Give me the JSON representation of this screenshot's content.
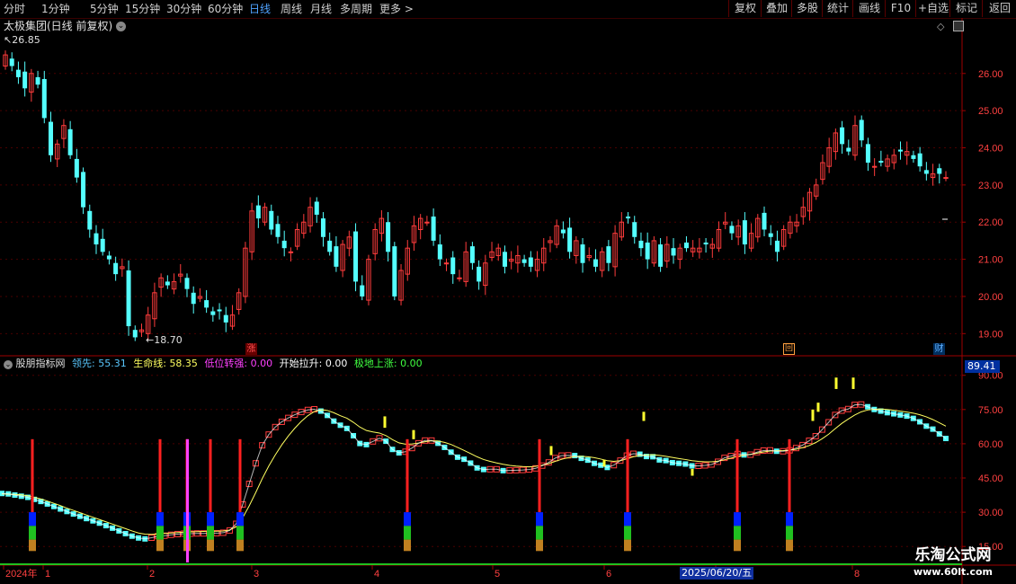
{
  "toolbar": {
    "periods": [
      "分时",
      "1分钟",
      "5分钟",
      "15分钟",
      "30分钟",
      "60分钟",
      "日线",
      "周线",
      "月线",
      "多周期",
      "更多 >"
    ],
    "active": "日线",
    "right_buttons": [
      "复权",
      "叠加",
      "多股",
      "统计",
      "画线",
      "F10",
      "+自选",
      "标记",
      "返回"
    ]
  },
  "main_chart": {
    "title": "太极集团(日线 前复权)",
    "high_label": "26.85",
    "low_label": "18.70",
    "y_ticks": [
      "26.00",
      "25.00",
      "24.00",
      "23.00",
      "22.00",
      "21.00",
      "20.00",
      "19.00"
    ],
    "markers": [
      {
        "text": "涨",
        "color": "#ff3030"
      },
      {
        "text": "回",
        "color": "#ffa040"
      },
      {
        "text": "财",
        "color": "#40a0ff"
      }
    ]
  },
  "indicator": {
    "name": "股朋指标网",
    "items": [
      {
        "label": "领先:",
        "value": "55.31",
        "color": "#5ac8ff"
      },
      {
        "label": "生命线:",
        "value": "58.35",
        "color": "#ffff60"
      },
      {
        "label": "低位转强:",
        "value": "0.00",
        "color": "#ff40ff"
      },
      {
        "label": "开始拉升:",
        "value": "0.00",
        "color": "#ffffff"
      },
      {
        "label": "极地上涨:",
        "value": "0.00",
        "color": "#40ff40"
      }
    ],
    "current_value": "89.41",
    "y_ticks": [
      "90.00",
      "75.00",
      "60.00",
      "45.00",
      "30.00",
      "15.00"
    ]
  },
  "time_axis": {
    "labels": [
      "2024年",
      "1",
      "2",
      "3",
      "4",
      "5",
      "6",
      "7",
      "8"
    ],
    "highlight": "2025/06/20/五"
  },
  "watermark": {
    "title": "乐淘公式网",
    "url": "www.60lt.com"
  },
  "colors": {
    "up": "#ff3c3c",
    "down": "#54ffff",
    "axis": "#a00000",
    "grid": "#4a0000",
    "life": "#ffff60"
  },
  "chart_data": [
    {
      "type": "candlestick",
      "title": "太极集团(日线 前复权)",
      "ylim": [
        18.5,
        27.3
      ],
      "close": [
        26.5,
        26.2,
        25.9,
        25.6,
        26.0,
        25.7,
        24.8,
        23.8,
        24.1,
        24.6,
        23.8,
        23.2,
        22.4,
        21.8,
        21.4,
        21.2,
        21.0,
        20.6,
        20.8,
        19.2,
        18.9,
        19.1,
        19.5,
        20.1,
        20.5,
        20.3,
        20.4,
        20.6,
        20.2,
        19.8,
        20.0,
        19.7,
        19.5,
        19.6,
        19.3,
        19.5,
        20.1,
        21.3,
        22.3,
        22.1,
        22.4,
        21.8,
        21.6,
        21.3,
        21.2,
        21.8,
        22.0,
        22.4,
        22.2,
        21.6,
        21.2,
        20.8,
        21.4,
        21.6,
        20.4,
        20.0,
        21.0,
        21.8,
        22.1,
        21.2,
        20.0,
        20.7,
        21.3,
        21.9,
        22.1,
        22.0,
        21.5,
        21.0,
        20.9,
        20.6,
        20.5,
        21.2,
        20.9,
        20.4,
        20.9,
        21.2,
        21.3,
        20.8,
        21.0,
        21.1,
        20.9,
        20.8,
        21.0,
        21.3,
        21.5,
        21.9,
        21.7,
        21.2,
        21.5,
        20.9,
        21.1,
        20.8,
        21.2,
        20.9,
        21.7,
        22.0,
        22.1,
        21.6,
        21.3,
        21.0,
        21.5,
        20.8,
        21.4,
        21.1,
        21.3,
        21.3,
        21.3,
        21.3,
        21.4,
        21.4,
        21.8,
        22.0,
        21.7,
        21.9,
        21.4,
        21.7,
        22.1,
        21.8,
        21.6,
        21.2,
        21.8,
        22.0,
        22.0,
        22.4,
        22.8,
        23.0,
        23.6,
        24.0,
        24.4,
        24.1,
        23.9,
        24.6,
        24.2,
        23.6,
        23.5,
        23.6,
        23.7,
        23.8,
        23.9,
        23.9,
        23.7,
        23.5,
        23.3,
        23.3,
        23.3,
        23.2
      ]
    },
    {
      "type": "bar",
      "title": "股朋指标网",
      "ylim": [
        8,
        95
      ],
      "series": [
        {
          "name": "领先",
          "values": [
            39.4,
            39.2,
            38.7,
            38.2,
            37.7,
            36.8,
            35.9,
            34.8,
            33.7,
            32.6,
            31.5,
            30.4,
            29.4,
            28.4,
            27.4,
            26.4,
            25.3,
            24.2,
            23.0,
            21.8,
            20.7,
            19.9,
            19.5,
            20.0,
            20.7,
            20.9,
            21.3,
            21.6,
            21.8,
            21.8,
            21.9,
            21.9,
            22.0,
            22.0,
            22.2,
            23.2,
            26.1,
            34.6,
            43.6,
            52.6,
            60.5,
            65.2,
            68.5,
            70.8,
            72.5,
            73.9,
            75.1,
            76.0,
            76.3,
            75.5,
            73.6,
            71.1,
            69.3,
            67.9,
            64.7,
            61.3,
            60.8,
            62.2,
            63.6,
            62.3,
            58.7,
            57.2,
            57.7,
            59.3,
            61.4,
            62.6,
            62.6,
            61.4,
            59.6,
            57.5,
            55.3,
            54.4,
            52.7,
            50.6,
            49.9,
            50.0,
            50.0,
            49.4,
            49.5,
            49.6,
            49.7,
            49.9,
            50.4,
            51.6,
            53.0,
            54.9,
            56.0,
            56.1,
            56.0,
            54.8,
            54.0,
            52.6,
            51.8,
            50.8,
            51.8,
            53.8,
            56.0,
            56.8,
            56.6,
            55.6,
            55.5,
            54.1,
            53.8,
            52.9,
            52.6,
            52.3,
            51.5,
            51.5,
            51.7,
            52.1,
            53.3,
            55.0,
            55.8,
            56.7,
            56.3,
            56.4,
            57.5,
            58.2,
            58.3,
            57.9,
            57.9,
            58.3,
            59.3,
            60.6,
            62.5,
            64.5,
            67.4,
            70.6,
            73.8,
            75.7,
            76.4,
            78.2,
            78.4,
            77.4,
            76.2,
            75.5,
            74.8,
            74.3,
            73.8,
            73.3,
            72.3,
            70.8,
            68.9,
            67.6,
            65.5,
            63.5
          ]
        },
        {
          "name": "生命线",
          "values": [
            38.0,
            37.9,
            37.8,
            37.6,
            37.2,
            36.5,
            35.8,
            34.9,
            33.9,
            32.9,
            31.8,
            30.8,
            29.8,
            28.8,
            27.8,
            26.8,
            25.8,
            24.8,
            23.8,
            22.8,
            21.8,
            20.9,
            20.4,
            20.3,
            20.5,
            20.7,
            20.9,
            21.1,
            21.3,
            21.4,
            21.5,
            21.6,
            21.7,
            21.7,
            21.8,
            22.2,
            23.6,
            27.6,
            32.8,
            38.6,
            44.7,
            50.2,
            55.1,
            59.5,
            63.4,
            66.8,
            69.8,
            72.3,
            74.1,
            74.9,
            74.6,
            73.6,
            72.3,
            71.2,
            69.4,
            67.3,
            65.8,
            65.2,
            64.7,
            63.6,
            61.8,
            60.4,
            59.8,
            59.9,
            60.3,
            60.9,
            61.3,
            61.2,
            60.6,
            59.7,
            58.4,
            57.1,
            55.7,
            54.3,
            53.1,
            52.3,
            51.6,
            51.0,
            50.5,
            50.2,
            50.0,
            49.9,
            50.1,
            50.6,
            51.3,
            52.3,
            53.2,
            53.9,
            54.4,
            54.5,
            54.3,
            53.9,
            53.3,
            52.6,
            52.3,
            52.6,
            53.4,
            54.3,
            54.9,
            55.1,
            55.2,
            54.9,
            54.5,
            54.0,
            53.5,
            53.1,
            52.6,
            52.3,
            52.1,
            52.1,
            52.4,
            53.0,
            53.7,
            54.5,
            55.0,
            55.4,
            55.9,
            56.4,
            56.8,
            56.9,
            57.0,
            57.2,
            57.6,
            58.3,
            59.2,
            60.5,
            62.2,
            64.2,
            66.6,
            68.9,
            70.8,
            72.6,
            74.0,
            74.8,
            75.1,
            75.2,
            75.0,
            74.7,
            74.3,
            73.9,
            73.4,
            72.7,
            71.8,
            70.6,
            69.2,
            67.7
          ]
        }
      ]
    }
  ]
}
